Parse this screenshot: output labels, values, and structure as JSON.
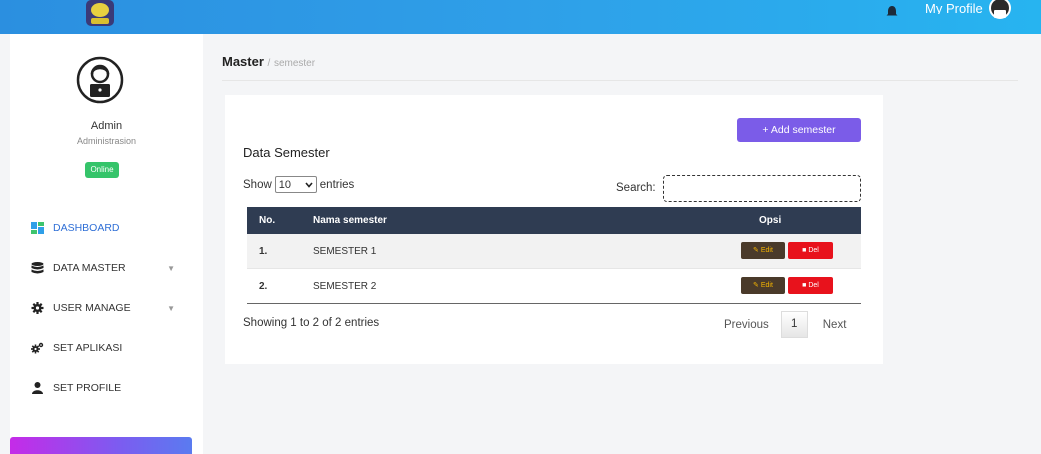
{
  "topbar": {
    "profile_label": "My Profile"
  },
  "sidebar": {
    "user_name": "Admin",
    "user_role": "Administrasion",
    "status_badge": "Online",
    "items": [
      {
        "label": "DASHBOARD",
        "icon": "dashboard-icon",
        "active": true
      },
      {
        "label": "DATA MASTER",
        "icon": "database-icon",
        "has_submenu": true
      },
      {
        "label": "USER MANAGE",
        "icon": "gear-icon",
        "has_submenu": true
      },
      {
        "label": "SET APLIKASI",
        "icon": "gears-icon"
      },
      {
        "label": "SET PROFILE",
        "icon": "user-icon"
      }
    ]
  },
  "breadcrumb": {
    "parent": "Master",
    "separator": "/",
    "current": "semester"
  },
  "card": {
    "add_button": "+ Add semester",
    "title": "Data Semester",
    "show_prefix": "Show",
    "show_value": "10",
    "show_suffix": "entries",
    "search_label": "Search:",
    "search_value": ""
  },
  "table": {
    "headers": [
      "No.",
      "Nama semester",
      "Opsi"
    ],
    "rows": [
      {
        "no": "1.",
        "name": "SEMESTER 1",
        "edit": "Edit",
        "del": "Del"
      },
      {
        "no": "2.",
        "name": "SEMESTER 2",
        "edit": "Edit",
        "del": "Del"
      }
    ]
  },
  "footer": {
    "info": "Showing 1 to 2 of 2 entries",
    "previous": "Previous",
    "page": "1",
    "next": "Next"
  },
  "colors": {
    "topbar": "#2f9fe8",
    "accent": "#7b5ce8",
    "table_header": "#2f3c52",
    "online": "#35c46a",
    "delete": "#e8121c"
  }
}
